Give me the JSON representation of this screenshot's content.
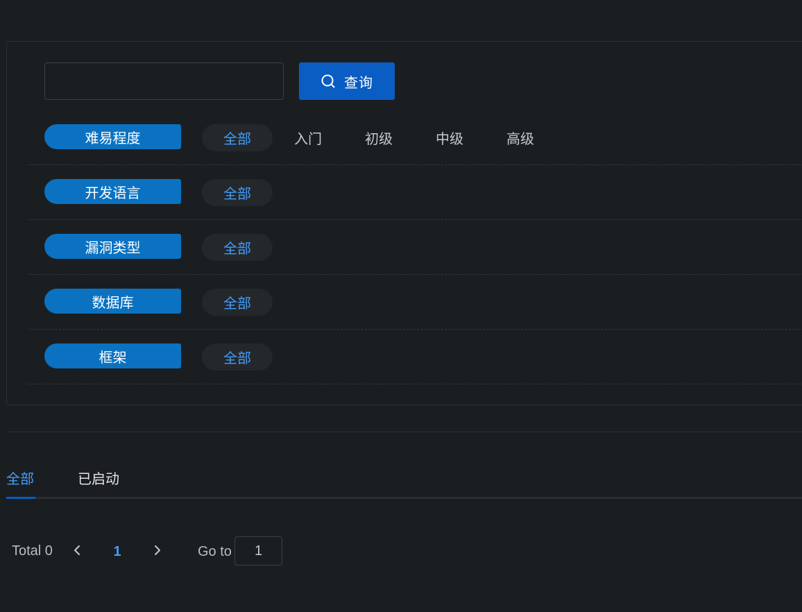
{
  "search": {
    "value": "",
    "button_label": "查询",
    "button_icon": "search-icon"
  },
  "filters": [
    {
      "label": "难易程度",
      "options": [
        "全部",
        "入门",
        "初级",
        "中级",
        "高级"
      ],
      "selected": "全部"
    },
    {
      "label": "开发语言",
      "options": [
        "全部"
      ],
      "selected": "全部"
    },
    {
      "label": "漏洞类型",
      "options": [
        "全部"
      ],
      "selected": "全部"
    },
    {
      "label": "数据库",
      "options": [
        "全部"
      ],
      "selected": "全部"
    },
    {
      "label": "框架",
      "options": [
        "全部"
      ],
      "selected": "全部"
    }
  ],
  "tabs": [
    {
      "label": "全部",
      "active": true
    },
    {
      "label": "已启动",
      "active": false
    }
  ],
  "pagination": {
    "total_text": "Total 0",
    "current_page": "1",
    "goto_label": "Go to",
    "goto_value": "1",
    "prev_icon": "chevron-left-icon",
    "next_icon": "chevron-right-icon"
  },
  "colors": {
    "background": "#1b1e20",
    "accent": "#409eff",
    "primary_button": "#0a5dc2",
    "label_pill": "#0b72c1"
  }
}
